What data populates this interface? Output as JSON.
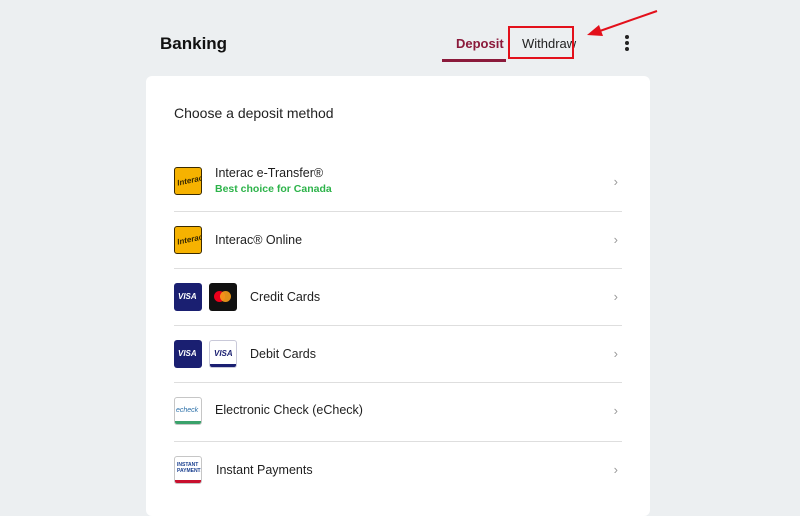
{
  "header": {
    "title": "Banking",
    "tabs": [
      {
        "label": "Deposit",
        "active": true
      },
      {
        "label": "Withdraw",
        "active": false
      }
    ],
    "menu_icon": "kebab-menu-icon"
  },
  "annotation": {
    "highlight_color": "#e3101b",
    "target": "Withdraw"
  },
  "colors": {
    "accent": "#8b1a3b",
    "recommend": "#2db34a",
    "background": "#eceff1"
  },
  "deposit": {
    "heading": "Choose a deposit method",
    "methods": [
      {
        "name": "Interac e-Transfer®",
        "sub": "Best choice for Canada",
        "icons": [
          "interac-logo"
        ]
      },
      {
        "name": "Interac® Online",
        "sub": "",
        "icons": [
          "interac-logo"
        ]
      },
      {
        "name": "Credit Cards",
        "sub": "",
        "icons": [
          "visa-logo",
          "mastercard-logo"
        ]
      },
      {
        "name": "Debit Cards",
        "sub": "",
        "icons": [
          "visa-logo",
          "visa-debit-logo"
        ]
      },
      {
        "name": "Electronic Check (eCheck)",
        "sub": "",
        "icons": [
          "echeck-logo"
        ]
      },
      {
        "name": "Instant Payments",
        "sub": "",
        "icons": [
          "instant-payments-logo"
        ]
      }
    ]
  },
  "logos": {
    "interac": "Interac",
    "visa": "VISA",
    "echeck": "echeck",
    "instant": "INSTANT PAYMENTS"
  }
}
